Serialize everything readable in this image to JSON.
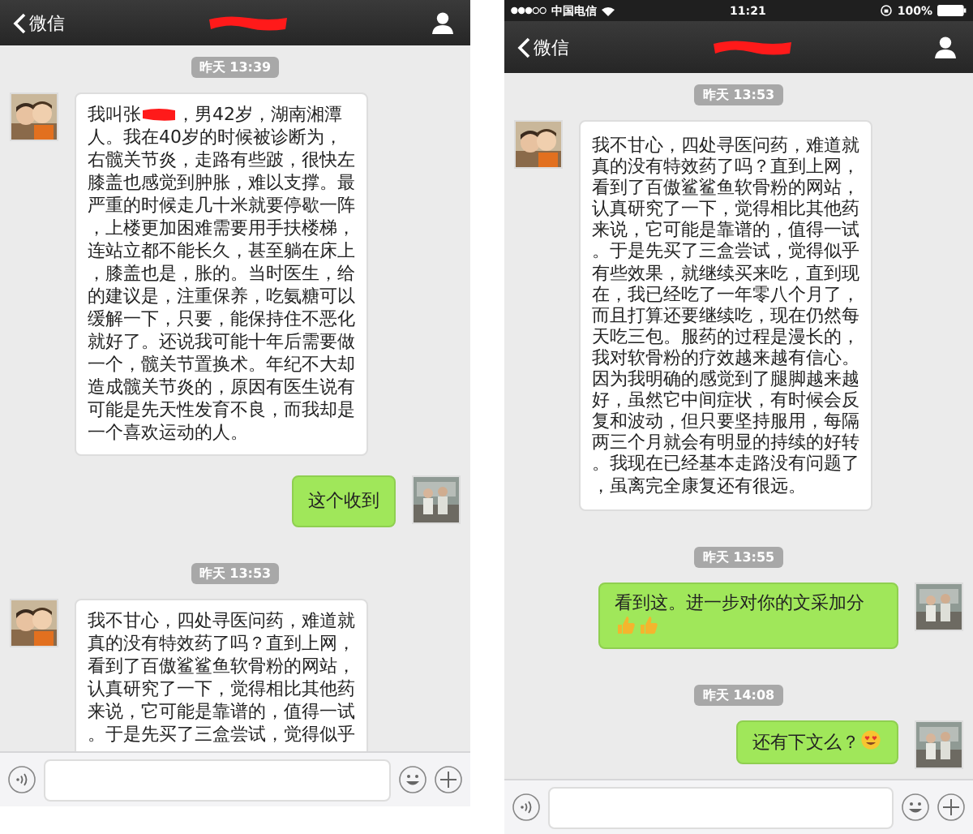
{
  "screens": [
    {
      "nav": {
        "back_label": "微信",
        "title": {
          "kind": "redaction"
        }
      },
      "messages": [
        {
          "kind": "timestamp",
          "text": "昨天 13:39"
        },
        {
          "kind": "received",
          "segments": [
            {
              "kind": "text",
              "text": "我叫张"
            },
            {
              "kind": "redaction"
            },
            {
              "kind": "text",
              "text": "，男42岁，湖南湘潭"
            },
            {
              "kind": "paragraph",
              "text": "人。我在40岁的时候被诊断为，右髋关节炎，走路有些跛，很快左膝盖也感觉到肿胀，难以支撑。最严重的时候走几十米就要停歇一阵，上楼更加困难需要用手扶楼梯，连站立都不能长久，甚至躺在床上，膝盖也是，胀的。当时医生，给的建议是，注重保养，吃氨糖可以缓解一下，只要，能保持住不恶化就好了。还说我可能十年后需要做一个，髋关节置换术。年纪不大却造成髋关节炎的，原因有医生说有可能是先天性发育不良，而我却是一个喜欢运动的人。"
            }
          ]
        },
        {
          "kind": "sent",
          "segments": [
            {
              "kind": "text",
              "text": "这个收到"
            }
          ]
        },
        {
          "kind": "timestamp",
          "text": "昨天 13:53"
        },
        {
          "kind": "received",
          "segments": [
            {
              "kind": "text",
              "text": "我不甘心，四处寻医问药，难道就真的没有特效药了吗？直到上网，看到了百傲鲨鲨鱼软骨粉的网站，认真研究了一下，觉得相比其他药来说，它可能是靠谱的，值得一试。于是先买了三盒尝试，觉得似乎"
            }
          ]
        }
      ]
    },
    {
      "status_bar": {
        "carrier": "中国电信",
        "time": "11:21",
        "battery": "100%"
      },
      "nav": {
        "back_label": "微信",
        "title": {
          "kind": "redaction"
        }
      },
      "messages": [
        {
          "kind": "timestamp",
          "text": "昨天 13:53"
        },
        {
          "kind": "received",
          "segments": [
            {
              "kind": "text",
              "text": "我不甘心，四处寻医问药，难道就真的没有特效药了吗？直到上网，看到了百傲鲨鲨鱼软骨粉的网站，认真研究了一下，觉得相比其他药来说，它可能是靠谱的，值得一试。于是先买了三盒尝试，觉得似乎有些效果，就继续买来吃，直到现在，我已经吃了一年零八个月了，而且打算还要继续吃，现在仍然每天吃三包。服药的过程是漫长的，我对软骨粉的疗效越来越有信心。因为我明确的感觉到了腿脚越来越好，虽然它中间症状，有时候会反复和波动，但只要坚持服用，每隔两三个月就会有明显的持续的好转。我现在已经基本走路没有问题了，虽离完全康复还有很远。"
            }
          ]
        },
        {
          "kind": "timestamp",
          "text": "昨天 13:55"
        },
        {
          "kind": "sent",
          "segments": [
            {
              "kind": "text",
              "text": "看到这。进一步对你的文采加分"
            },
            {
              "kind": "thumbs_up"
            },
            {
              "kind": "thumbs_up"
            }
          ]
        },
        {
          "kind": "timestamp",
          "text": "昨天 14:08"
        },
        {
          "kind": "sent",
          "segments": [
            {
              "kind": "text",
              "text": "还有下文么？"
            },
            {
              "kind": "heart_eyes"
            }
          ]
        }
      ]
    }
  ]
}
